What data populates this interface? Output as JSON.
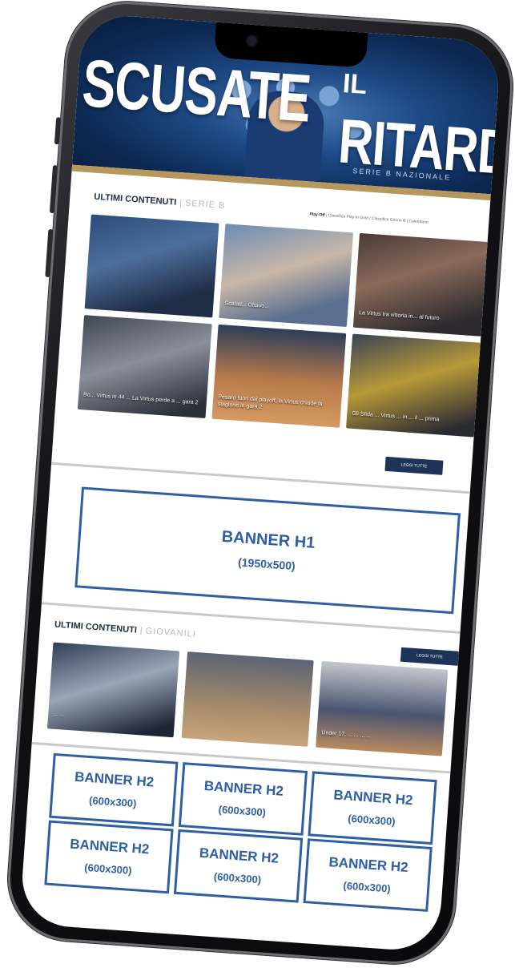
{
  "hero": {
    "title_line1": "SCUSATE",
    "title_il": "IL",
    "title_line2": "RITARDO",
    "subtitle": "SERIE B NAZIONALE"
  },
  "serie_b": {
    "heading": "ULTIMI CONTENUTI",
    "subheading": "SERIE B",
    "links_lead": "Play-Off",
    "links_rest": "| Classifica Play-In Gold | Classifica Girone B | Calendario",
    "read_all": "LEGGI TUTTE",
    "tiles": [
      {
        "caption": ""
      },
      {
        "caption": "Scafati... Ottavo..."
      },
      {
        "caption": "La Virtus tra vittoria in... al futuro"
      },
      {
        "caption": "Bo... Virtus in 44 ... La Virtus perde a ... gara 2"
      },
      {
        "caption": "Pesaro fuori dai playoff, la Virtus chiude la stagione in gara 2"
      },
      {
        "caption": "Gli Sfida ... Virtus ... in ... il ... prima"
      }
    ]
  },
  "banner_h1": {
    "label": "BANNER H1",
    "size": "(1950x500)"
  },
  "giovanili": {
    "heading": "ULTIMI CONTENUTI",
    "subheading": "GIOVANILI",
    "read_all": "LEGGI TUTTE",
    "tiles": [
      {
        "caption": "... ..."
      },
      {
        "caption": ""
      },
      {
        "caption": "Under 17, ... ... ... ..."
      }
    ]
  },
  "banner_h2": [
    {
      "label": "BANNER H2",
      "size": "(600x300)"
    },
    {
      "label": "BANNER H2",
      "size": "(600x300)"
    },
    {
      "label": "BANNER H2",
      "size": "(600x300)"
    },
    {
      "label": "BANNER H2",
      "size": "(600x300)"
    },
    {
      "label": "BANNER H2",
      "size": "(600x300)"
    },
    {
      "label": "BANNER H2",
      "size": "(600x300)"
    }
  ],
  "colors": {
    "navy": "#1d3458",
    "gold": "#b6985f",
    "banner_blue": "#2e5fa3"
  }
}
